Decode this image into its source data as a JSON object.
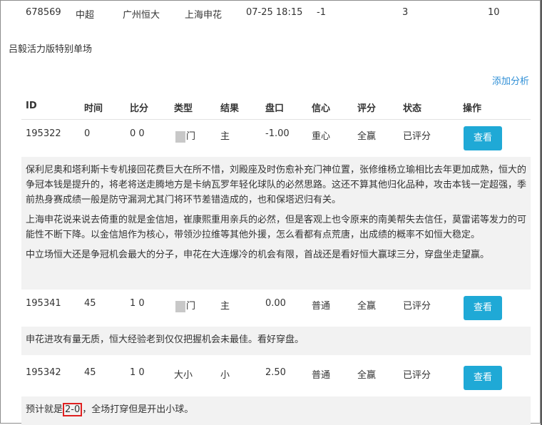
{
  "top_row": {
    "id": "678569",
    "league": "中超",
    "home": "广州恒大",
    "away": "上海申花",
    "time": "07-25 18:15",
    "handicap": "-1",
    "col_a": "3",
    "col_b": "10"
  },
  "page_title": "吕毅活力版特别单场",
  "add_analysis": "添加分析",
  "table": {
    "headers": [
      "ID",
      "时间",
      "比分",
      "类型",
      "结果",
      "盘口",
      "信心",
      "评分",
      "状态",
      "操作"
    ],
    "rows": [
      {
        "id": "195322",
        "time": "0",
        "score": "0 0",
        "type": "让门",
        "result": "主",
        "handicap": "-1.00",
        "confidence": "重心",
        "rating": "全赢",
        "status": "已评分",
        "action": "查看",
        "analysis": [
          "保利尼奥和塔利斯卡专机接回花费巨大在所不惜，刘殿座及时伤愈补充门神位置，张修维杨立瑜相比去年更加成熟，恒大的争冠本钱是提升的，将老将送走腾地方是卡纳瓦罗年轻化球队的必然思路。这还不算其他归化品种，攻击本钱一定超强，季前热身赛成绩一般是防守漏洞尤其门将环节差错造成的，也和保塔迟归有关。",
          "上海申花说来说去倚重的就是金信旭，崔康熙重用亲兵的必然，但是客观上也令原来的南美帮失去信任，莫雷诺等发力的可能性不断下降。以金信旭作为核心，带领沙拉维等其他外援，怎么看都有点荒唐，出成绩的概率不如恒大稳定。",
          "中立场恒大还是争冠机会最大的分子，申花在大连爆冷的机会有限，首战还是看好恒大赢球三分，穿盘坐走望赢。"
        ]
      },
      {
        "id": "195341",
        "time": "45",
        "score": "1 0",
        "type": "让门",
        "result": "主",
        "handicap": "0.00",
        "confidence": "普通",
        "rating": "全赢",
        "status": "已评分",
        "action": "查看",
        "analysis": [
          "申花进攻有量无质，恒大经验老到仅仅把握机会未最佳。看好穿盘。"
        ]
      },
      {
        "id": "195342",
        "time": "45",
        "score": "1 0",
        "type": "大小",
        "result": "小",
        "handicap": "2.50",
        "confidence": "普通",
        "rating": "全赢",
        "status": "已评分",
        "action": "查看",
        "analysis_prefix": "预计就是",
        "analysis_highlight": "2-0",
        "analysis_suffix": "，全场打穿但是开出小球。"
      }
    ]
  },
  "colors": {
    "button": "#1fa9d6",
    "link": "#2f8fd6",
    "highlight_box": "#e02020",
    "analysis_bg": "#f2f2f2"
  }
}
